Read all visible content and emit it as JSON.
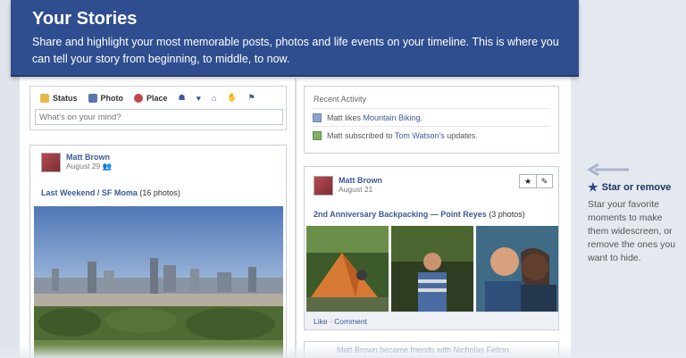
{
  "banner": {
    "title": "Your Stories",
    "text": "Share and highlight your most memorable posts, photos and life events on your timeline. This is where you can tell your story from beginning, to middle, to now."
  },
  "publisher": {
    "tabs": [
      {
        "label": "Status",
        "icon": "status-icon",
        "color": "#d9a53a"
      },
      {
        "label": "Photo",
        "icon": "photo-icon",
        "color": "#5a76b0"
      },
      {
        "label": "Place",
        "icon": "place-icon",
        "color": "#c0464a"
      }
    ],
    "placeholder": "What's on your mind?"
  },
  "recent": {
    "title": "Recent Activity",
    "items": [
      {
        "prefix": "Matt likes ",
        "link": "Mountain Biking",
        "suffix": "."
      },
      {
        "prefix": "Matt subscribed to ",
        "link": "Tom Watson's",
        "suffix": " updates."
      }
    ]
  },
  "story_left": {
    "author": "Matt Brown",
    "date": "August 29",
    "album": "Last Weekend / SF Moma",
    "count": "(16 photos)"
  },
  "story_right": {
    "author": "Matt Brown",
    "date": "August 21",
    "album": "2nd Anniversary Backpacking — Point Reyes",
    "count": "(3 photos)",
    "footer": "Like · Comment"
  },
  "peek": {
    "text": "Matt Brown became friends with Nicholas Felton"
  },
  "hint": {
    "title": "Star or remove",
    "text": "Star your favorite moments to make them widescreen, or remove the ones you want to hide."
  },
  "colors": {
    "banner": "#2f4e8f",
    "link": "#3b5998"
  }
}
